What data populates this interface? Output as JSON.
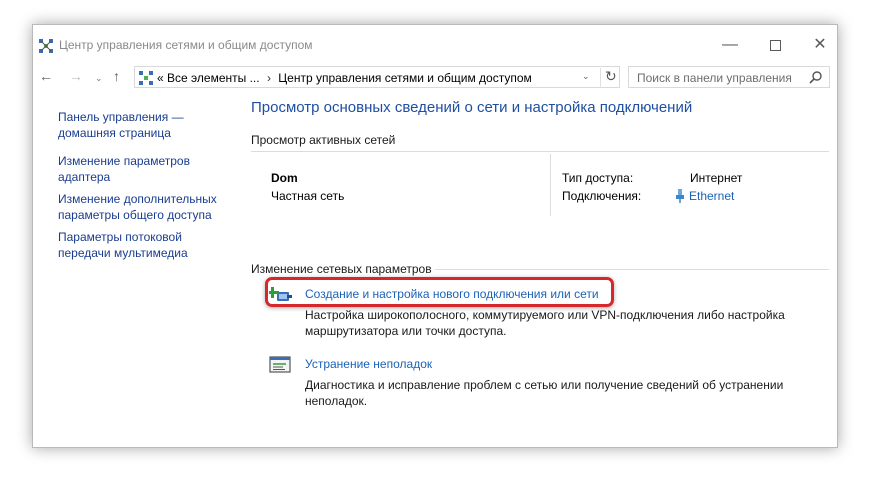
{
  "window": {
    "title": "Центр управления сетями и общим доступом",
    "controls": {
      "minimize": "—",
      "close": "✕"
    }
  },
  "nav": {
    "back": "←",
    "forward": "→",
    "dropdown": "⌄",
    "up": "↑"
  },
  "address": {
    "overflow": "«",
    "crumbs": [
      "Все элементы ...",
      "Центр управления сетями и общим доступом"
    ],
    "separator": "›",
    "refresh": "↻",
    "dropdown": "⌄"
  },
  "search": {
    "placeholder": "Поиск в панели управления"
  },
  "sidebar": {
    "items": [
      {
        "lines": [
          "Панель управления —",
          "домашняя страница"
        ]
      },
      {
        "lines": [
          "Изменение параметров",
          "адаптера"
        ]
      },
      {
        "lines": [
          "Изменение дополнительных",
          "параметры общего доступа"
        ]
      },
      {
        "lines": [
          "Параметры потоковой",
          "передачи мультимедиа"
        ]
      }
    ]
  },
  "main": {
    "title": "Просмотр основных сведений о сети и настройка подключений",
    "active_networks_label": "Просмотр активных сетей",
    "network": {
      "name": "Dom",
      "type": "Частная сеть",
      "access_label": "Тип доступа:",
      "access_value": "Интернет",
      "connections_label": "Подключения:",
      "connection_name": "Ethernet"
    },
    "change_label": "Изменение сетевых параметров",
    "tasks": [
      {
        "icon": "new-connection-icon",
        "link": "Создание и настройка нового подключения или сети",
        "desc": "Настройка широкополосного, коммутируемого или VPN-подключения либо настройка маршрутизатора или точки доступа."
      },
      {
        "icon": "troubleshoot-icon",
        "link": "Устранение неполадок",
        "desc": "Диагностика и исправление проблем с сетью или получение сведений об устранении неполадок."
      }
    ]
  },
  "colors": {
    "link": "#1a62b8",
    "title_blue": "#1f4fa3",
    "highlight_red": "#d6272a"
  }
}
